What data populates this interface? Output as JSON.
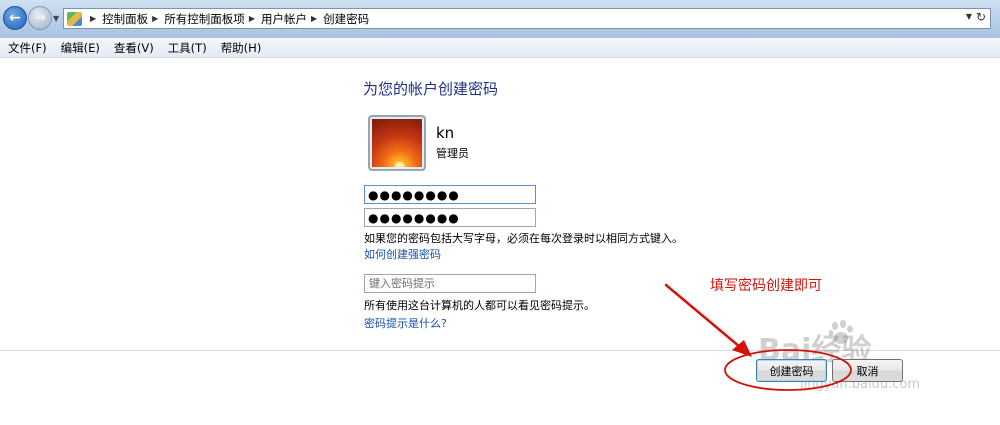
{
  "addressbar": {
    "breadcrumbs": [
      "控制面板",
      "所有控制面板项",
      "用户帐户",
      "创建密码"
    ]
  },
  "menu": [
    "文件(F)",
    "编辑(E)",
    "查看(V)",
    "工具(T)",
    "帮助(H)"
  ],
  "content": {
    "heading": "为您的帐户创建密码",
    "user": {
      "name": "kn",
      "role": "管理员"
    },
    "new_password": "●●●●●●●●",
    "confirm_password": "●●●●●●●●",
    "case_note": "如果您的密码包括大写字母，必须在每次登录时以相同方式键入。",
    "strong_password_link": "如何创建强密码",
    "hint_placeholder": "键入密码提示",
    "hint_note": "所有使用这台计算机的人都可以看见密码提示。",
    "hint_link": "密码提示是什么?"
  },
  "buttons": {
    "create": "创建密码",
    "cancel": "取消"
  },
  "annotation": {
    "text": "填写密码创建即可",
    "color": "#d0150a"
  },
  "watermark": {
    "brand": "Bai经验",
    "url": "jingyan.baidu.com"
  }
}
